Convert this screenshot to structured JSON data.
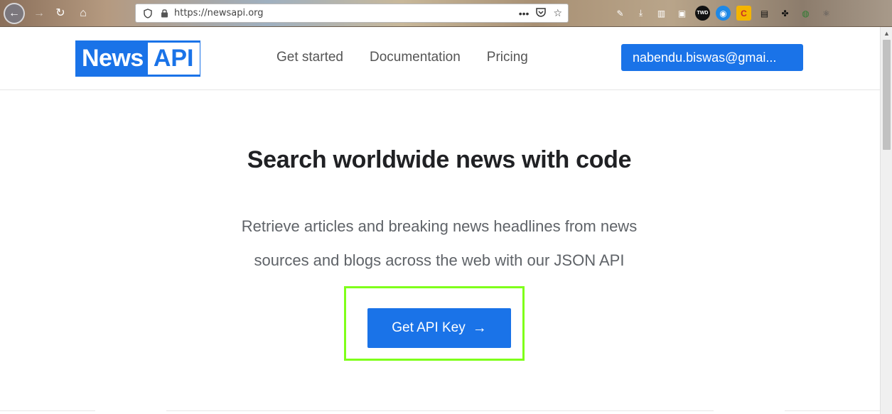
{
  "browser": {
    "url": "https://newsapi.org",
    "back_icon": "←",
    "reload_icon": "↻",
    "home_icon": "⌂",
    "more_icon": "•••",
    "star_icon": "☆"
  },
  "site": {
    "logo_news": "News",
    "logo_api": "API",
    "nav": [
      "Get started",
      "Documentation",
      "Pricing"
    ],
    "account_label": "nabendu.biswas@gmai..."
  },
  "hero": {
    "title": "Search worldwide news with code",
    "subtitle": "Retrieve articles and breaking news headlines from news sources and blogs across the web with our JSON API",
    "cta_label": "Get API Key",
    "cta_arrow": "→"
  },
  "colors": {
    "brand_blue": "#1a73e8",
    "highlight_green": "#7fff1a",
    "title_text": "#202124",
    "body_text": "#5f6368"
  },
  "icons": [
    "back-icon",
    "forward-icon",
    "reload-icon",
    "home-icon",
    "shield-icon",
    "lock-icon",
    "more-icon",
    "pocket-icon",
    "star-icon",
    "arrow-right-icon"
  ]
}
